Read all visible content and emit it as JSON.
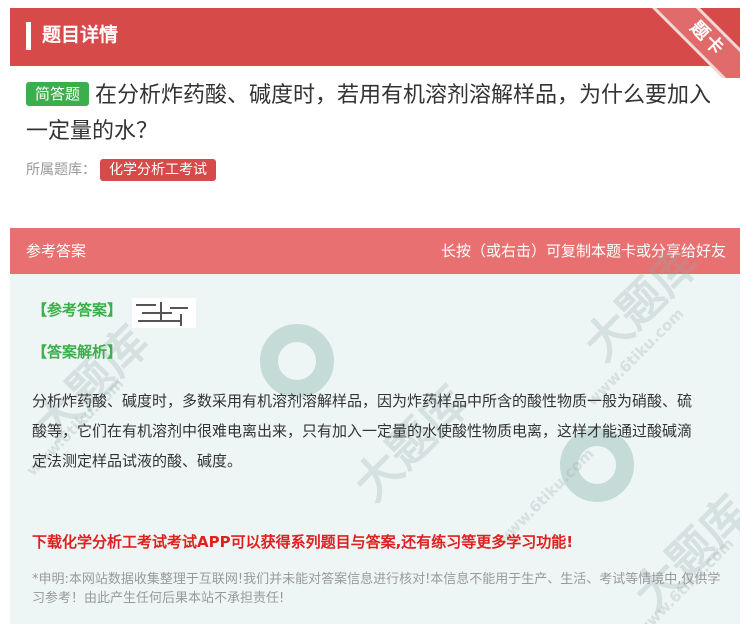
{
  "header": {
    "title": "题目详情",
    "corner_badge": "题卡"
  },
  "question": {
    "type_tag": "简答题",
    "text": "在分析炸药酸、碱度时，若用有机溶剂溶解样品，为什么要加入一定量的水？",
    "bank_label": "所属题库：",
    "bank_name": "化学分析工考试"
  },
  "answer_card": {
    "header_left": "参考答案",
    "header_right": "长按（或右击）可复制本题卡或分享给好友",
    "ref_answer_label": "【参考答案】",
    "analysis_label": "【答案解析】",
    "analysis_text": "分析炸药酸、碱度时，多数采用有机溶剂溶解样品，因为炸药样品中所含的酸性物质一般为硝酸、硫酸等，它们在有机溶剂中很难电离出来，只有加入一定量的水使酸性物质电离，这样才能通过酸碱滴定法测定样品试液的酸、碱度。",
    "promo_text": "下载化学分析工考试考试APP可以获得系列题目与答案,还有练习等更多学习功能!",
    "disclaimer_text": "*申明:本网站数据收集整理于互联网!我们并未能对答案信息进行核对!本信息不能用于生产、生活、考试等情境中,仅供学习参考！由此产生任何后果本站不承担责任!"
  },
  "watermark": {
    "brand": "大题库",
    "domain": "www.6tiku.com"
  },
  "colors": {
    "header_red": "#d74a4a",
    "card_header": "#e87070",
    "card_bg": "#eef6f5",
    "green_accent": "#3cae4b",
    "promo_red": "#e02020"
  }
}
